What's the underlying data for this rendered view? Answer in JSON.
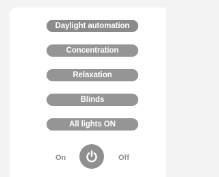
{
  "scenes": [
    {
      "label": "Daylight automation"
    },
    {
      "label": "Concentration"
    },
    {
      "label": "Relaxation"
    },
    {
      "label": "Blinds"
    },
    {
      "label": "All lights ON"
    }
  ],
  "power": {
    "on_label": "On",
    "off_label": "Off",
    "icon": "power-icon"
  },
  "colors": {
    "button_bg": "#959595",
    "button_text": "#ffffff",
    "label_text": "#8e8e8e",
    "panel_bg": "#ffffff",
    "page_bg": "#f3f3f3"
  }
}
